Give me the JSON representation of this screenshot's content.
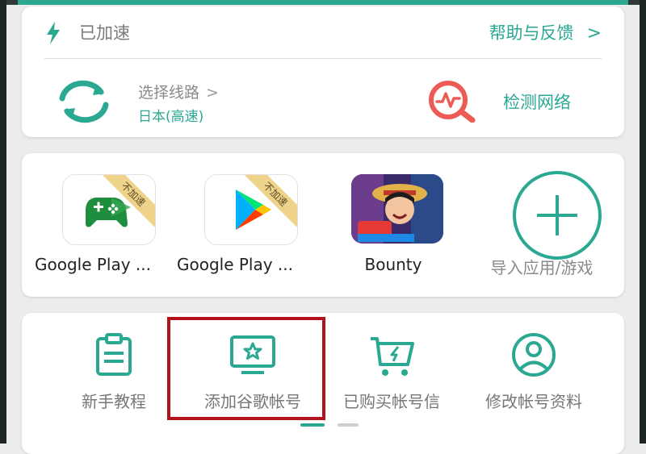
{
  "status": {
    "text": "已加速",
    "help_label": "帮助与反馈",
    "help_chevron": ">"
  },
  "route": {
    "title": "选择线路",
    "chevron": ">",
    "value": "日本(高速)"
  },
  "network": {
    "detect_label": "检测网络"
  },
  "apps": [
    {
      "label": "Google Play ...",
      "badge": "不加速",
      "icon": "google-play-games-icon"
    },
    {
      "label": "Google Play ...",
      "badge": "不加速",
      "icon": "google-play-store-icon"
    },
    {
      "label": "Bounty",
      "icon": "bounty-game-icon"
    },
    {
      "label": "导入应用/游戏",
      "icon": "plus-icon"
    }
  ],
  "tools": [
    {
      "label": "新手教程",
      "icon": "clipboard-icon"
    },
    {
      "label": "添加谷歌帐号",
      "icon": "monitor-star-icon"
    },
    {
      "label": "已购买帐号信",
      "icon": "cart-icon"
    },
    {
      "label": "修改帐号资料",
      "icon": "user-circle-icon"
    }
  ],
  "colors": {
    "accent": "#2aa892",
    "detect_red": "#ec5b54",
    "highlight": "#b3121c"
  }
}
